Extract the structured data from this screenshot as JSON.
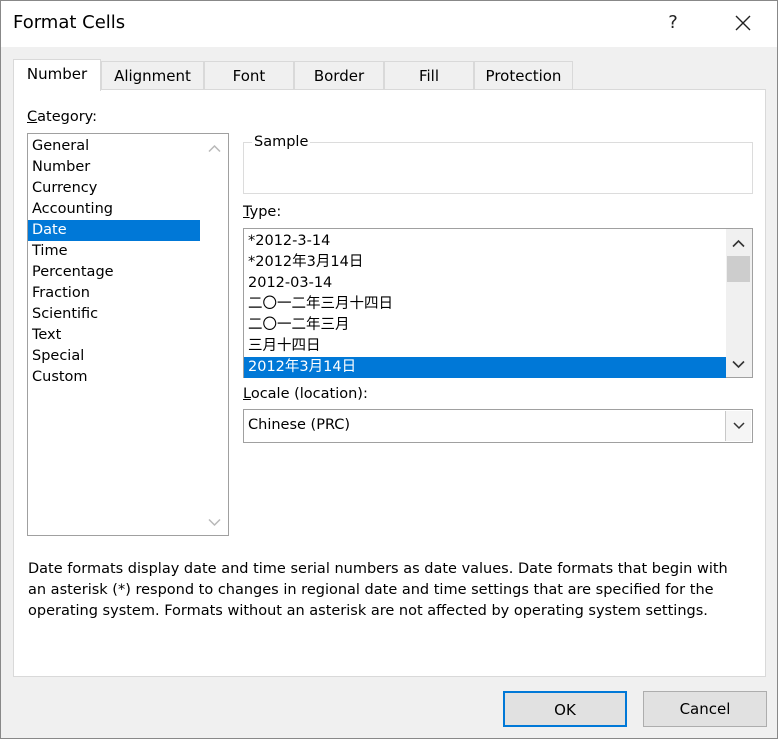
{
  "window": {
    "title": "Format Cells",
    "help_label": "?",
    "close_icon": "close-icon"
  },
  "tabs": [
    {
      "label": "Number",
      "active": true
    },
    {
      "label": "Alignment",
      "active": false
    },
    {
      "label": "Font",
      "active": false
    },
    {
      "label": "Border",
      "active": false
    },
    {
      "label": "Fill",
      "active": false
    },
    {
      "label": "Protection",
      "active": false
    }
  ],
  "category": {
    "label_prefix": "C",
    "label_rest": "ategory:",
    "items": [
      "General",
      "Number",
      "Currency",
      "Accounting",
      "Date",
      "Time",
      "Percentage",
      "Fraction",
      "Scientific",
      "Text",
      "Special",
      "Custom"
    ],
    "selected": "Date"
  },
  "sample": {
    "legend": "Sample",
    "value": ""
  },
  "type": {
    "label_prefix": "T",
    "label_rest": "ype:",
    "items": [
      "*2012-3-14",
      "*2012年3月14日",
      "2012-03-14",
      "二〇一二年三月十四日",
      "二〇一二年三月",
      "三月十四日",
      "2012年3月14日"
    ],
    "selected": "2012年3月14日"
  },
  "locale": {
    "label_prefix": "L",
    "label_rest": "ocale (location):",
    "value": "Chinese (PRC)"
  },
  "description": "Date formats display date and time serial numbers as date values.  Date formats that begin with an asterisk (*) respond to changes in regional date and time settings that are specified for the operating system. Formats without an asterisk are not affected by operating system settings.",
  "buttons": {
    "ok": "OK",
    "cancel": "Cancel"
  },
  "colors": {
    "selection": "#0078d7",
    "button_border_default": "#0078d7"
  }
}
